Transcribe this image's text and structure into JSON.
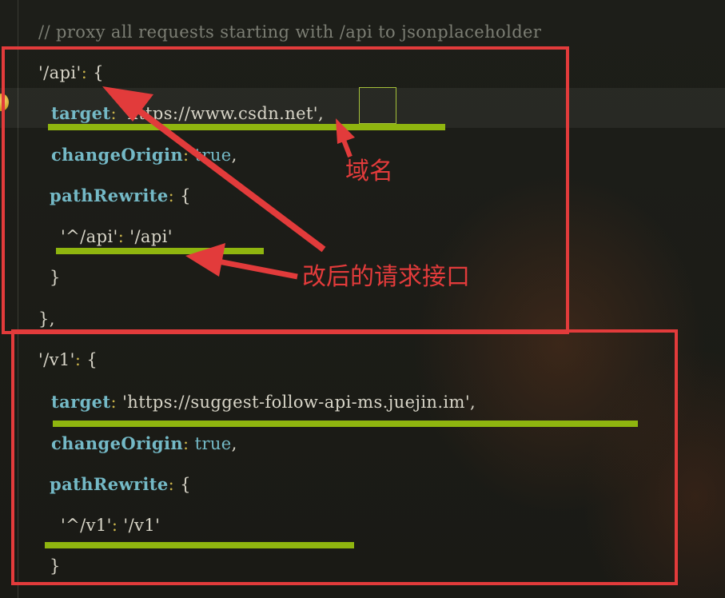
{
  "editor": {
    "comment": "// proxy all requests starting with /api to jsonplaceholder",
    "proxies": [
      {
        "path": "'/api'",
        "target_key": "target",
        "target_value": "'https://www.csdn.net'",
        "changeOrigin_key": "changeOrigin",
        "changeOrigin_value": "true",
        "pathRewrite_key": "pathRewrite",
        "rewrite_from": "'^/api'",
        "rewrite_to": "'/api'"
      },
      {
        "path": "'/v1'",
        "target_key": "target",
        "target_value": "'https://suggest-follow-api-ms.juejin.im'",
        "changeOrigin_key": "changeOrigin",
        "changeOrigin_value": "true",
        "pathRewrite_key": "pathRewrite",
        "rewrite_from": "'^/v1'",
        "rewrite_to": "'/v1'"
      }
    ],
    "symbols": {
      "colon": ":",
      "comma": ",",
      "open_brace": "{",
      "close_brace": "}",
      "close_brace_comma": "},"
    }
  },
  "annotations": {
    "domain_label": "域名",
    "rewrite_label": "改后的请求接口"
  },
  "colors": {
    "annotation_red": "#e23b3b",
    "underline_green": "#8fb50f",
    "key_blue": "#74b9c6",
    "background": "#1b1c17"
  }
}
